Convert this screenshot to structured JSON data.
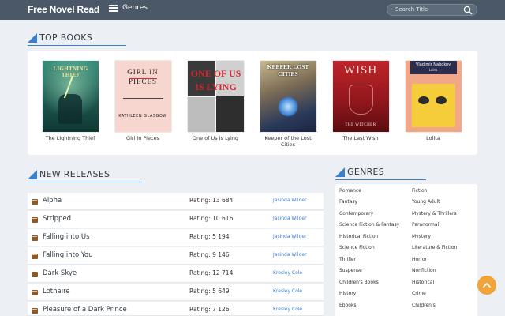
{
  "header": {
    "logo": "Free Novel Read",
    "menu_label": "Genres",
    "search_placeholder": "Search Title"
  },
  "top_books": {
    "title": "TOP BOOKS",
    "items": [
      {
        "title": "The Lightning Thief",
        "cover_text": "LIGHTNING THIEF"
      },
      {
        "title": "Girl in Pieces",
        "cover_text": "GIRL IN PIECES",
        "cover_author": "KATHLEEN GLASGOW"
      },
      {
        "title": "One of Us Is Lying",
        "cover_text": "ONE OF US IS LYING"
      },
      {
        "title": "Keeper of the Lost Cities",
        "cover_text": "KEEPER LOST CITIES"
      },
      {
        "title": "The Last Wish",
        "cover_text": "WISH",
        "cover_sub": "THE WITCHER"
      },
      {
        "title": "Lolita",
        "cover_author": "Vladimir Nabokov",
        "cover_text": "Lolita"
      }
    ]
  },
  "new_releases": {
    "title": "NEW RELEASES",
    "rows": [
      {
        "title": "Alpha",
        "rating": "Rating: 13 684",
        "author": "Jasinda Wilder"
      },
      {
        "title": "Stripped",
        "rating": "Rating: 10 616",
        "author": "Jasinda Wilder"
      },
      {
        "title": "Falling into Us",
        "rating": "Rating: 5 194",
        "author": "Jasinda Wilder"
      },
      {
        "title": "Falling into You",
        "rating": "Rating: 9 146",
        "author": "Jasinda Wilder"
      },
      {
        "title": "Dark Skye",
        "rating": "Rating: 12 714",
        "author": "Kresley Cole"
      },
      {
        "title": "Lothaire",
        "rating": "Rating: 5 649",
        "author": "Kresley Cole"
      },
      {
        "title": "Pleasure of a Dark Prince",
        "rating": "Rating: 7 126",
        "author": "Kresley Cole"
      }
    ]
  },
  "genres": {
    "title": "GENRES",
    "left": [
      "Romance",
      "Fantasy",
      "Contemporary",
      "Science Fiction & Fantasy",
      "Historical Fiction",
      "Science Fiction",
      "Thriller",
      "Suspense",
      "Children's Books",
      "History",
      "Ebooks"
    ],
    "right": [
      "Fiction",
      "Young Adult",
      "Mystery & Thrillers",
      "Paranormal",
      "Mystery",
      "Literature & Fiction",
      "Horror",
      "Nonfiction",
      "Historical",
      "Crime",
      "Children's"
    ]
  },
  "colors": {
    "header": "#4a5868",
    "accent": "#3b7fd0",
    "fab": "#f0a43a"
  }
}
